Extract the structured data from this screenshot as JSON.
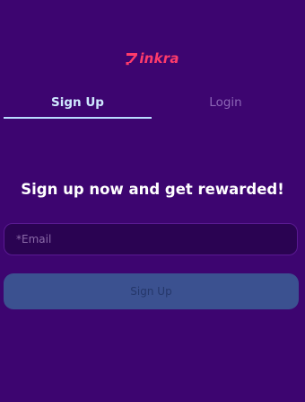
{
  "brand": {
    "name": "inkra",
    "icon": "zinkra-logo-icon",
    "color": "#ff3b6b"
  },
  "tabs": [
    {
      "label": "Sign Up",
      "active": true
    },
    {
      "label": "Login",
      "active": false
    }
  ],
  "headline": "Sign up now and get rewarded!",
  "form": {
    "email_placeholder": "*Email",
    "email_value": "",
    "submit_label": "Sign Up"
  },
  "colors": {
    "background": "#3d0570",
    "active_tab": "#cfe8ff",
    "button": "#3b5190"
  }
}
